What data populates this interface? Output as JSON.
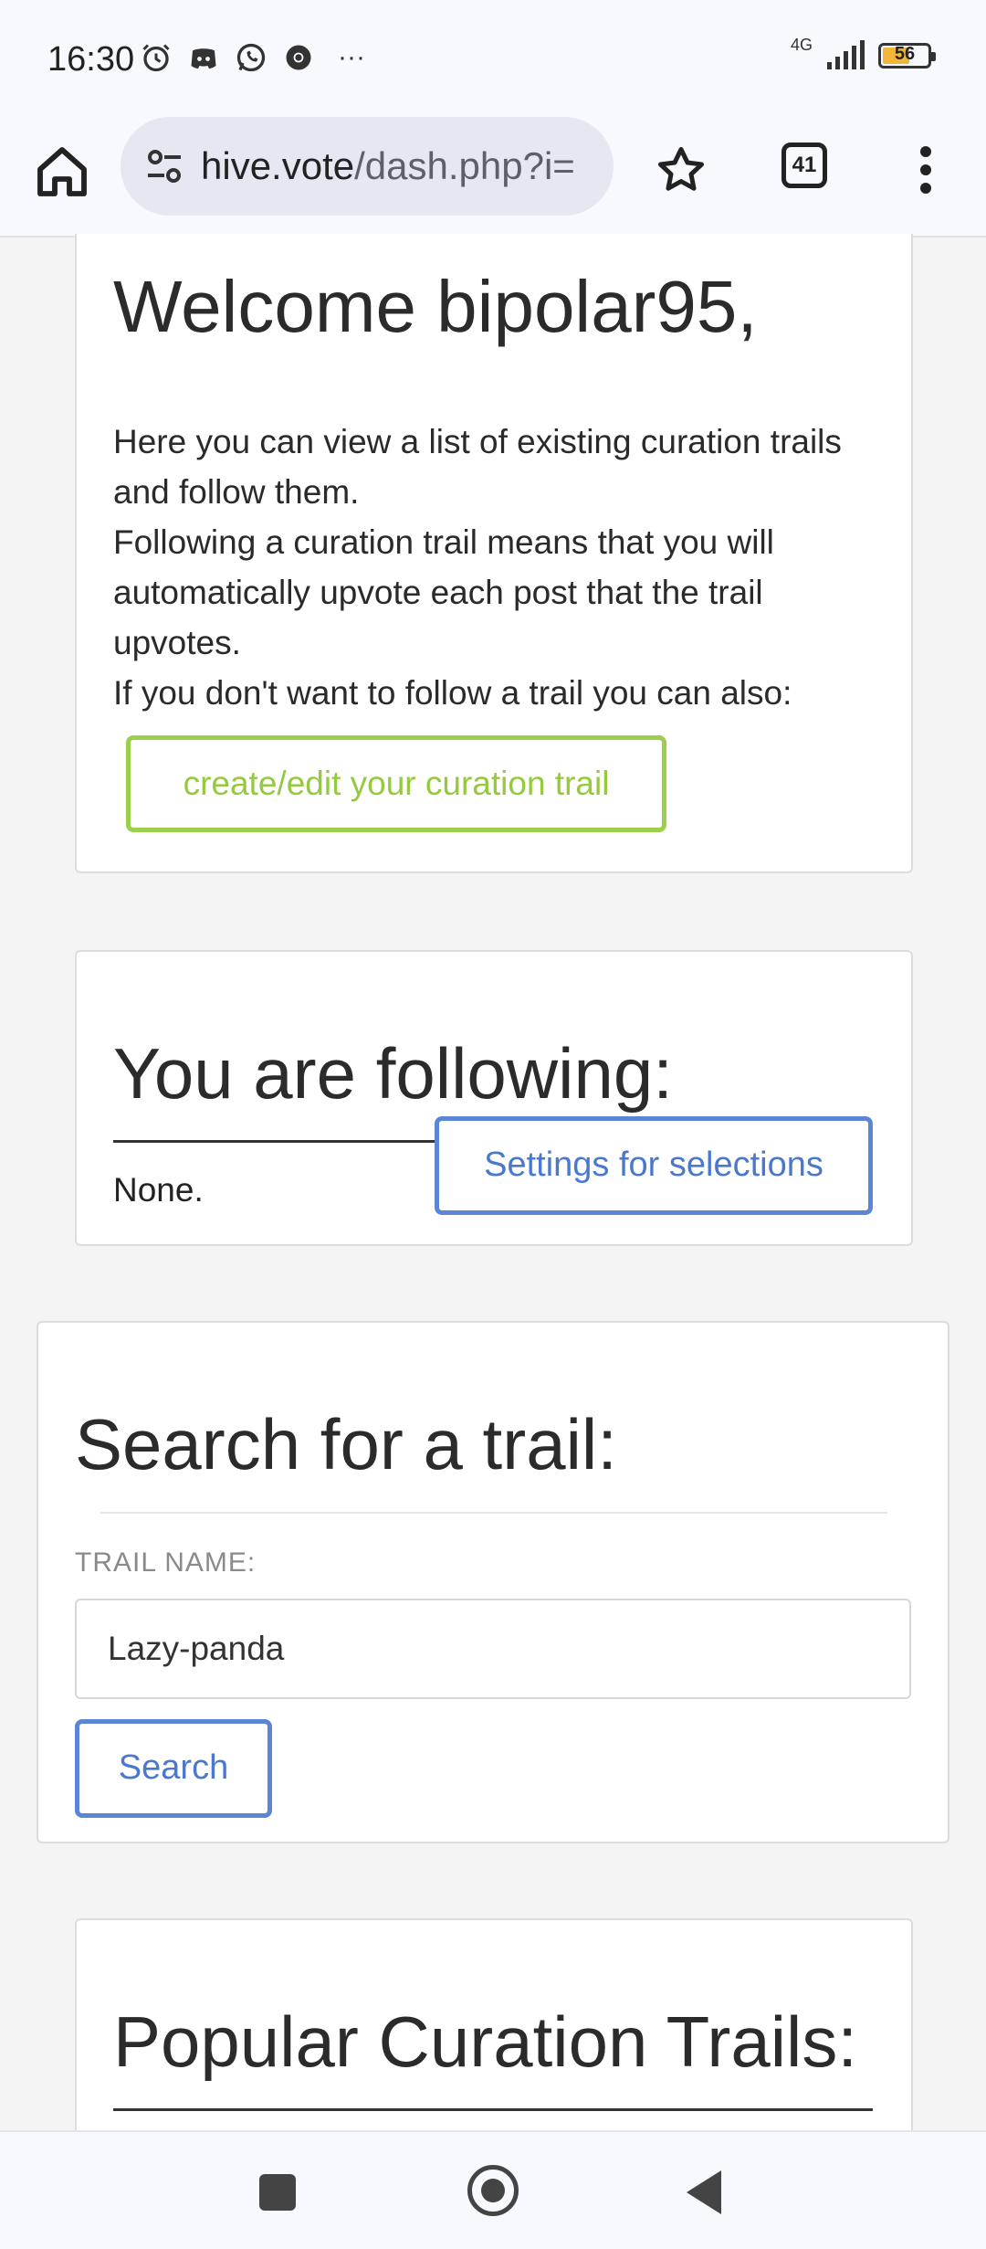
{
  "status_bar": {
    "time": "16:30",
    "network": "4G",
    "battery": "56",
    "overflow": "···",
    "icons": [
      "alarm-icon",
      "discord-icon",
      "whatsapp-icon",
      "chrome-icon"
    ]
  },
  "browser": {
    "url_domain": "hive.vote",
    "url_path": "/dash.php?i=",
    "tab_count": "41",
    "icons": [
      "home-icon",
      "site-settings-icon",
      "star-icon",
      "tabs-icon",
      "more-icon"
    ]
  },
  "welcome": {
    "title": "Welcome bipolar95,",
    "lines": [
      "Here you can view a list of existing curation trails and follow them.",
      "Following a curation trail means that you will automatically upvote each post that the trail upvotes.",
      "If you don't want to follow a trail you can also:"
    ],
    "button": "create/edit your curation trail"
  },
  "following": {
    "title": "You are following:",
    "value": "None.",
    "settings_button": "Settings for selections"
  },
  "search": {
    "title": "Search for a trail:",
    "label": "TRAIL NAME:",
    "input_value": "Lazy-panda",
    "button": "Search"
  },
  "popular": {
    "title": "Popular Curation Trails:"
  },
  "colors": {
    "green": "#95c93e",
    "blue": "#4b78cf",
    "accent_tab": "#2a52c9"
  }
}
